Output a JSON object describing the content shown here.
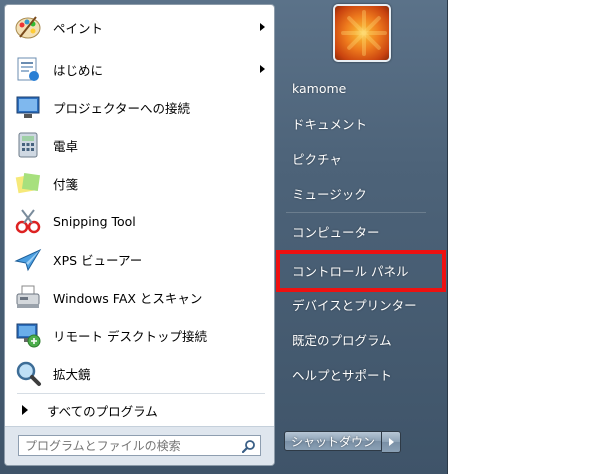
{
  "programs": [
    {
      "label": "ペイント",
      "icon": "paint-palette-icon",
      "has_submenu": true
    },
    {
      "label": "はじめに",
      "icon": "getting-started-icon",
      "has_submenu": true
    },
    {
      "label": "プロジェクターへの接続",
      "icon": "projector-icon",
      "has_submenu": false
    },
    {
      "label": "電卓",
      "icon": "calculator-icon",
      "has_submenu": false
    },
    {
      "label": "付箋",
      "icon": "sticky-notes-icon",
      "has_submenu": false
    },
    {
      "label": "Snipping Tool",
      "icon": "scissors-icon",
      "has_submenu": false
    },
    {
      "label": "XPS ビューアー",
      "icon": "xps-viewer-icon",
      "has_submenu": false
    },
    {
      "label": "Windows FAX とスキャン",
      "icon": "fax-icon",
      "has_submenu": false
    },
    {
      "label": "リモート デスクトップ接続",
      "icon": "remote-desktop-icon",
      "has_submenu": false
    },
    {
      "label": "拡大鏡",
      "icon": "magnifier-icon",
      "has_submenu": false
    }
  ],
  "all_programs_label": "すべてのプログラム",
  "search": {
    "placeholder": "プログラムとファイルの検索"
  },
  "right_pane": {
    "user_name": "kamome",
    "documents": "ドキュメント",
    "pictures": "ピクチャ",
    "music": "ミュージック",
    "computer": "コンピューター",
    "control_panel": "コントロール パネル",
    "devices_printers": "デバイスとプリンター",
    "default_programs": "既定のプログラム",
    "help_support": "ヘルプとサポート"
  },
  "shutdown_label": "シャットダウン",
  "colors": {
    "highlight": "#ee1111",
    "panel": "#4d6379"
  }
}
